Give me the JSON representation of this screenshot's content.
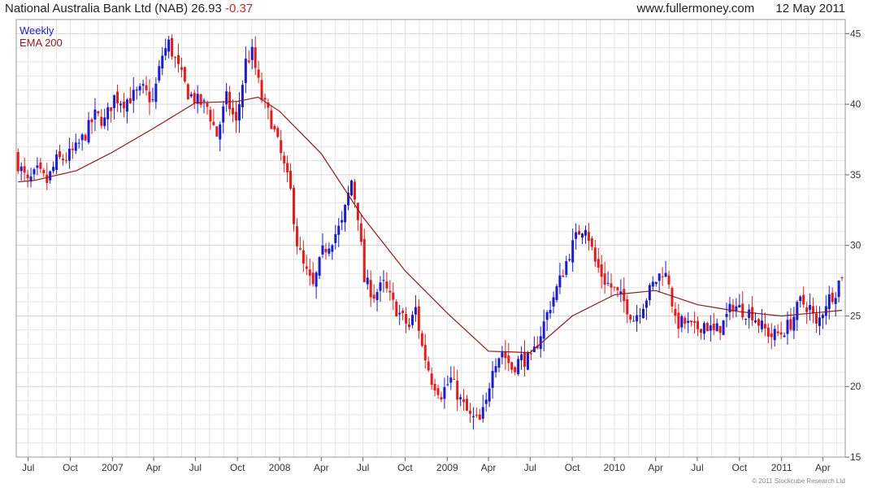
{
  "header": {
    "stock": "National Australia Bank Ltd (NAB)",
    "price": "26.93",
    "change": "-0.37",
    "site": "www.fullermoney.com",
    "date": "12 May 2011"
  },
  "copyright": "© 2011 Stockcube Research Ltd",
  "colors": {
    "up": "#1c1cc8",
    "down": "#e01e1e",
    "ema": "#8b1a1a",
    "grid": "#e4e4e4",
    "frame": "#9a9a9a"
  },
  "chart_data": {
    "type": "candlestick",
    "frequency_label": "Weekly",
    "ylim": [
      15,
      46
    ],
    "yticks": [
      15,
      20,
      25,
      30,
      35,
      40,
      45
    ],
    "x_range": [
      "2006-06-05",
      "2011-05-20"
    ],
    "xticks": [
      {
        "date": "2006-07-01",
        "label": "Jul"
      },
      {
        "date": "2006-10-01",
        "label": "Oct"
      },
      {
        "date": "2007-01-01",
        "label": "2007"
      },
      {
        "date": "2007-04-01",
        "label": "Apr"
      },
      {
        "date": "2007-07-01",
        "label": "Jul"
      },
      {
        "date": "2007-10-01",
        "label": "Oct"
      },
      {
        "date": "2008-01-01",
        "label": "2008"
      },
      {
        "date": "2008-04-01",
        "label": "Apr"
      },
      {
        "date": "2008-07-01",
        "label": "Jul"
      },
      {
        "date": "2008-10-01",
        "label": "Oct"
      },
      {
        "date": "2009-01-01",
        "label": "2009"
      },
      {
        "date": "2009-04-01",
        "label": "Apr"
      },
      {
        "date": "2009-07-01",
        "label": "Jul"
      },
      {
        "date": "2009-10-01",
        "label": "Oct"
      },
      {
        "date": "2010-01-01",
        "label": "2010"
      },
      {
        "date": "2010-04-01",
        "label": "Apr"
      },
      {
        "date": "2010-07-01",
        "label": "Jul"
      },
      {
        "date": "2010-10-01",
        "label": "Oct"
      },
      {
        "date": "2011-01-01",
        "label": "2011"
      },
      {
        "date": "2011-04-01",
        "label": "Apr"
      }
    ],
    "close_path": [
      [
        "2006-06-09",
        35.8
      ],
      [
        "2006-06-30",
        34.4
      ],
      [
        "2006-07-21",
        35.2
      ],
      [
        "2006-08-11",
        34.5
      ],
      [
        "2006-09-01",
        36.0
      ],
      [
        "2006-09-22",
        36.2
      ],
      [
        "2006-10-13",
        36.8
      ],
      [
        "2006-11-03",
        37.9
      ],
      [
        "2006-11-24",
        39.2
      ],
      [
        "2006-12-15",
        38.8
      ],
      [
        "2007-01-05",
        40.5
      ],
      [
        "2007-01-26",
        40.2
      ],
      [
        "2007-02-16",
        40.6
      ],
      [
        "2007-03-09",
        41.0
      ],
      [
        "2007-03-30",
        40.2
      ],
      [
        "2007-04-20",
        43.5
      ],
      [
        "2007-05-04",
        44.3
      ],
      [
        "2007-05-25",
        42.5
      ],
      [
        "2007-06-15",
        40.8
      ],
      [
        "2007-07-06",
        40.2
      ],
      [
        "2007-07-27",
        39.8
      ],
      [
        "2007-08-17",
        37.8
      ],
      [
        "2007-09-07",
        40.4
      ],
      [
        "2007-09-28",
        38.6
      ],
      [
        "2007-10-19",
        43.0
      ],
      [
        "2007-11-02",
        43.6
      ],
      [
        "2007-11-23",
        40.4
      ],
      [
        "2007-12-14",
        38.8
      ],
      [
        "2008-01-04",
        36.4
      ],
      [
        "2008-01-25",
        33.8
      ],
      [
        "2008-02-08",
        30.2
      ],
      [
        "2008-02-22",
        28.5
      ],
      [
        "2008-03-14",
        27.0
      ],
      [
        "2008-04-04",
        29.5
      ],
      [
        "2008-04-25",
        30.5
      ],
      [
        "2008-05-16",
        31.5
      ],
      [
        "2008-06-06",
        34.6
      ],
      [
        "2008-06-20",
        32.2
      ],
      [
        "2008-07-04",
        27.5
      ],
      [
        "2008-07-25",
        26.5
      ],
      [
        "2008-08-15",
        27.2
      ],
      [
        "2008-09-05",
        25.8
      ],
      [
        "2008-09-26",
        24.8
      ],
      [
        "2008-10-10",
        24.2
      ],
      [
        "2008-10-24",
        25.5
      ],
      [
        "2008-11-07",
        22.8
      ],
      [
        "2008-11-28",
        20.5
      ],
      [
        "2008-12-19",
        19.5
      ],
      [
        "2009-01-09",
        20.5
      ],
      [
        "2009-01-30",
        19.0
      ],
      [
        "2009-02-20",
        17.8
      ],
      [
        "2009-03-13",
        17.5
      ],
      [
        "2009-03-27",
        18.8
      ],
      [
        "2009-04-10",
        21.6
      ],
      [
        "2009-05-01",
        22.5
      ],
      [
        "2009-05-22",
        21.3
      ],
      [
        "2009-06-12",
        22.0
      ],
      [
        "2009-07-03",
        21.8
      ],
      [
        "2009-07-24",
        23.8
      ],
      [
        "2009-08-14",
        25.8
      ],
      [
        "2009-09-04",
        27.5
      ],
      [
        "2009-09-25",
        29.5
      ],
      [
        "2009-10-16",
        31.0
      ],
      [
        "2009-10-30",
        31.5
      ],
      [
        "2009-11-20",
        28.8
      ],
      [
        "2009-12-11",
        27.5
      ],
      [
        "2010-01-01",
        26.8
      ],
      [
        "2010-01-22",
        26.0
      ],
      [
        "2010-02-12",
        24.8
      ],
      [
        "2010-03-05",
        25.9
      ],
      [
        "2010-03-26",
        27.2
      ],
      [
        "2010-04-16",
        28.2
      ],
      [
        "2010-04-30",
        27.5
      ],
      [
        "2010-05-14",
        24.5
      ],
      [
        "2010-06-04",
        24.5
      ],
      [
        "2010-06-25",
        24.0
      ],
      [
        "2010-07-16",
        24.5
      ],
      [
        "2010-08-06",
        23.8
      ],
      [
        "2010-08-27",
        24.5
      ],
      [
        "2010-09-17",
        25.8
      ],
      [
        "2010-10-08",
        25.4
      ],
      [
        "2010-10-29",
        25.2
      ],
      [
        "2010-11-19",
        24.2
      ],
      [
        "2010-12-10",
        23.6
      ],
      [
        "2010-12-31",
        23.8
      ],
      [
        "2011-01-21",
        24.5
      ],
      [
        "2011-02-11",
        26.0
      ],
      [
        "2011-03-04",
        25.6
      ],
      [
        "2011-03-18",
        24.2
      ],
      [
        "2011-04-08",
        26.0
      ],
      [
        "2011-04-29",
        26.8
      ],
      [
        "2011-05-13",
        28.0
      ]
    ],
    "ema": {
      "label": "EMA 200",
      "points": [
        [
          "2006-06-09",
          34.5
        ],
        [
          "2006-07-15",
          34.6
        ],
        [
          "2006-10-15",
          35.3
        ],
        [
          "2007-01-01",
          36.6
        ],
        [
          "2007-04-01",
          38.3
        ],
        [
          "2007-07-01",
          40.1
        ],
        [
          "2007-10-01",
          40.2
        ],
        [
          "2007-11-15",
          40.5
        ],
        [
          "2008-01-01",
          39.5
        ],
        [
          "2008-04-01",
          36.5
        ],
        [
          "2008-07-01",
          32.0
        ],
        [
          "2008-10-01",
          28.2
        ],
        [
          "2009-01-01",
          25.2
        ],
        [
          "2009-04-01",
          22.5
        ],
        [
          "2009-07-01",
          22.4
        ],
        [
          "2009-10-01",
          25.0
        ],
        [
          "2010-01-01",
          26.5
        ],
        [
          "2010-04-01",
          26.8
        ],
        [
          "2010-07-01",
          25.8
        ],
        [
          "2010-10-01",
          25.3
        ],
        [
          "2011-01-01",
          25.0
        ],
        [
          "2011-05-13",
          25.4
        ]
      ]
    }
  }
}
